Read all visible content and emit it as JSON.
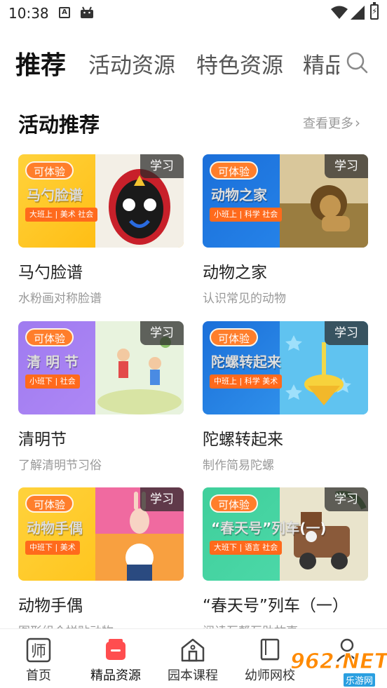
{
  "status_bar": {
    "time": "10:38",
    "icons": [
      "notification-a-icon",
      "android-icon",
      "wifi-icon",
      "signal-icon",
      "battery-charging-icon"
    ]
  },
  "top_tabs": {
    "items": [
      {
        "label": "推荐",
        "active": true
      },
      {
        "label": "活动资源",
        "active": false
      },
      {
        "label": "特色资源",
        "active": false
      },
      {
        "label": "精品",
        "active": false
      }
    ],
    "search_icon": "search-icon"
  },
  "section": {
    "title": "活动推荐",
    "see_more": "查看更多"
  },
  "cards": [
    {
      "name": "马勺脸谱",
      "desc": "水粉画对称脸谱",
      "thumb_title": "马勺脸谱",
      "thumb_tag": "大班上 | 美术  社会",
      "try_label": "可体验",
      "study_label": "学习",
      "grad_from": "#ffd23c",
      "grad_to": "#ffb400",
      "art_color": "#f3efe6"
    },
    {
      "name": "动物之家",
      "desc": "认识常见的动物",
      "thumb_title": "动物之家",
      "thumb_tag": "小班上 | 科学  社会",
      "try_label": "可体验",
      "study_label": "学习",
      "grad_from": "#1b6fd9",
      "grad_to": "#2a8cf0",
      "art_color": "#b89a5a"
    },
    {
      "name": "清明节",
      "desc": "了解清明节习俗",
      "thumb_title": "清 明 节",
      "thumb_tag": "小班下 | 社会",
      "try_label": "可体验",
      "study_label": "学习",
      "grad_from": "#9f7bf0",
      "grad_to": "#b58df7",
      "art_color": "#d7ecc4"
    },
    {
      "name": "陀螺转起来",
      "desc": "制作简易陀螺",
      "thumb_title": "陀螺转起来",
      "thumb_tag": "中班上 | 科学  美术",
      "try_label": "可体验",
      "study_label": "学习",
      "grad_from": "#1b6fd9",
      "grad_to": "#39a0f3",
      "art_color": "#68c6f2"
    },
    {
      "name": "动物手偶",
      "desc": "图形组合拼贴动物",
      "thumb_title": "动物手偶",
      "thumb_tag": "中班下 | 美术",
      "try_label": "可体验",
      "study_label": "学习",
      "grad_from": "#ffd23c",
      "grad_to": "#ffbf10",
      "art_color": "#f06aa0"
    },
    {
      "name": "“春天号”列车（一）",
      "desc": "阅读互帮互助故事",
      "thumb_title": "“春天号”列车(一)",
      "thumb_tag": "大班下 | 语言  社会",
      "try_label": "可体验",
      "study_label": "学习",
      "grad_from": "#3fcf9b",
      "grad_to": "#52dcae",
      "art_color": "#e8e2c8"
    }
  ],
  "bottom_nav": {
    "items": [
      {
        "label": "首页",
        "icon": "home-shi-icon",
        "active": false
      },
      {
        "label": "精品资源",
        "icon": "premium-resource-icon",
        "active": true
      },
      {
        "label": "园本课程",
        "icon": "school-building-icon",
        "active": false
      },
      {
        "label": "幼师网校",
        "icon": "book-icon",
        "active": false
      },
      {
        "label": "",
        "icon": "profile-icon",
        "active": false
      }
    ]
  },
  "watermark": {
    "text": "962.NET",
    "sub": "乐游网"
  },
  "colors": {
    "accent": "#ff4d4f",
    "try_badge": "#ff7e2b",
    "muted_text": "#999999"
  }
}
